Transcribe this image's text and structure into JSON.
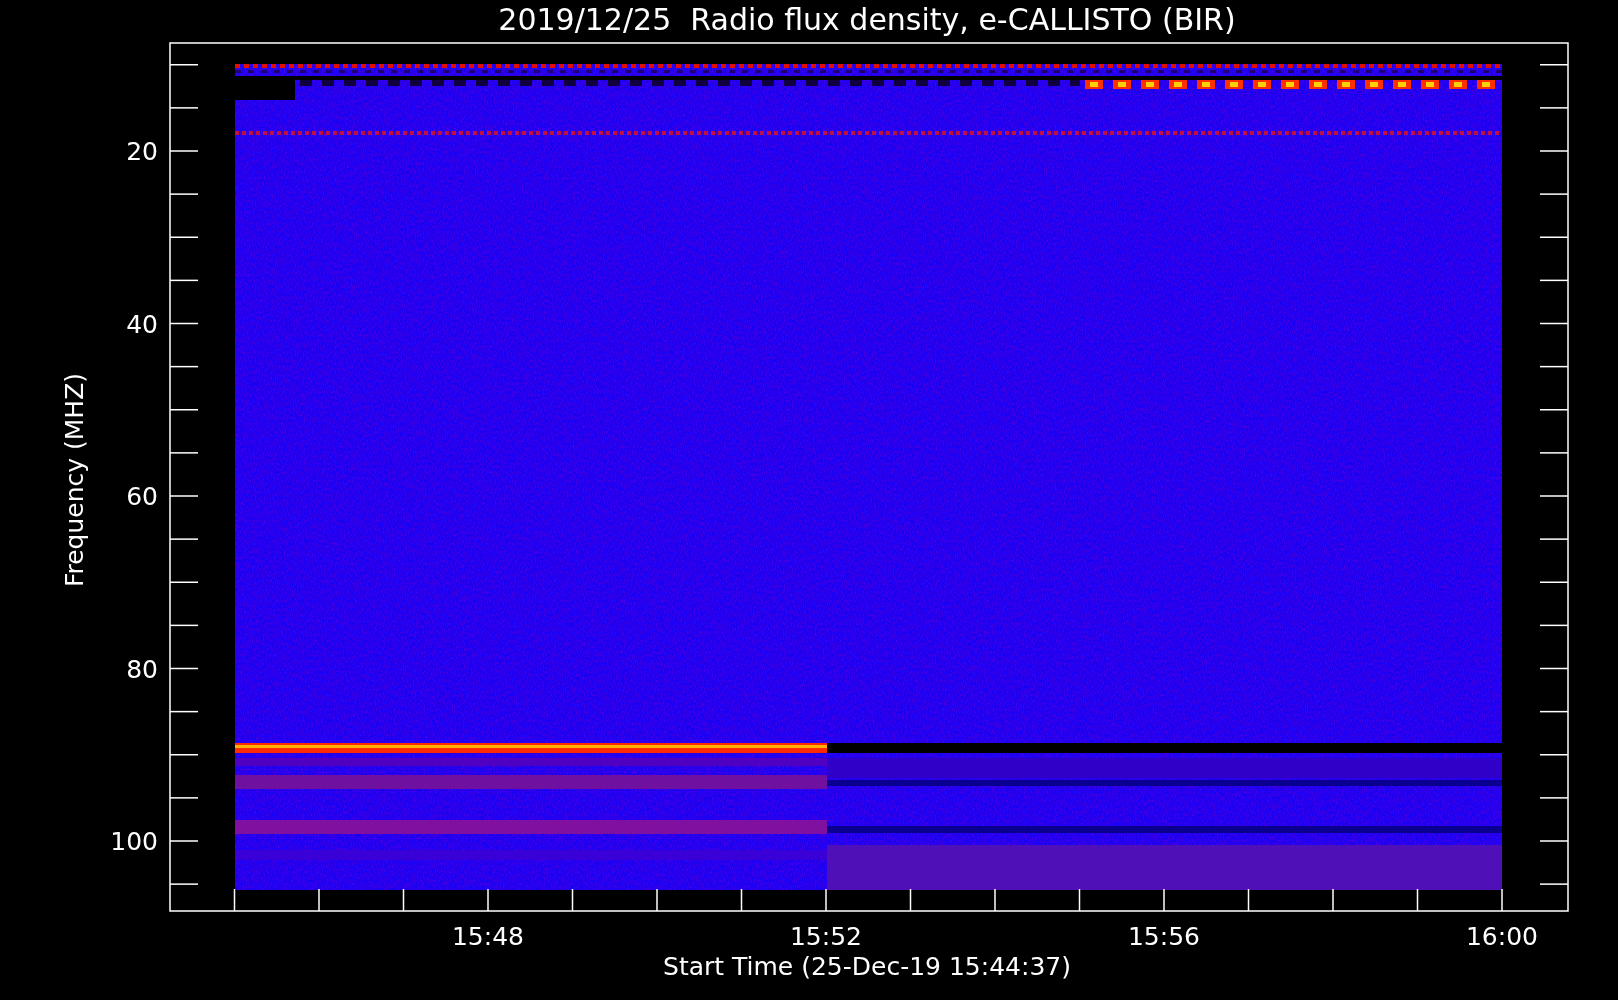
{
  "title": "2019/12/25  Radio flux density, e-CALLISTO (BIR)",
  "y_axis": {
    "label": "Frequency (MHZ)",
    "ticks": [
      "20",
      "40",
      "60",
      "80",
      "100"
    ]
  },
  "x_axis": {
    "label": "Start Time (25-Dec-19 15:44:37)",
    "ticks": [
      "15:48",
      "15:52",
      "15:56",
      "16:00"
    ]
  }
}
